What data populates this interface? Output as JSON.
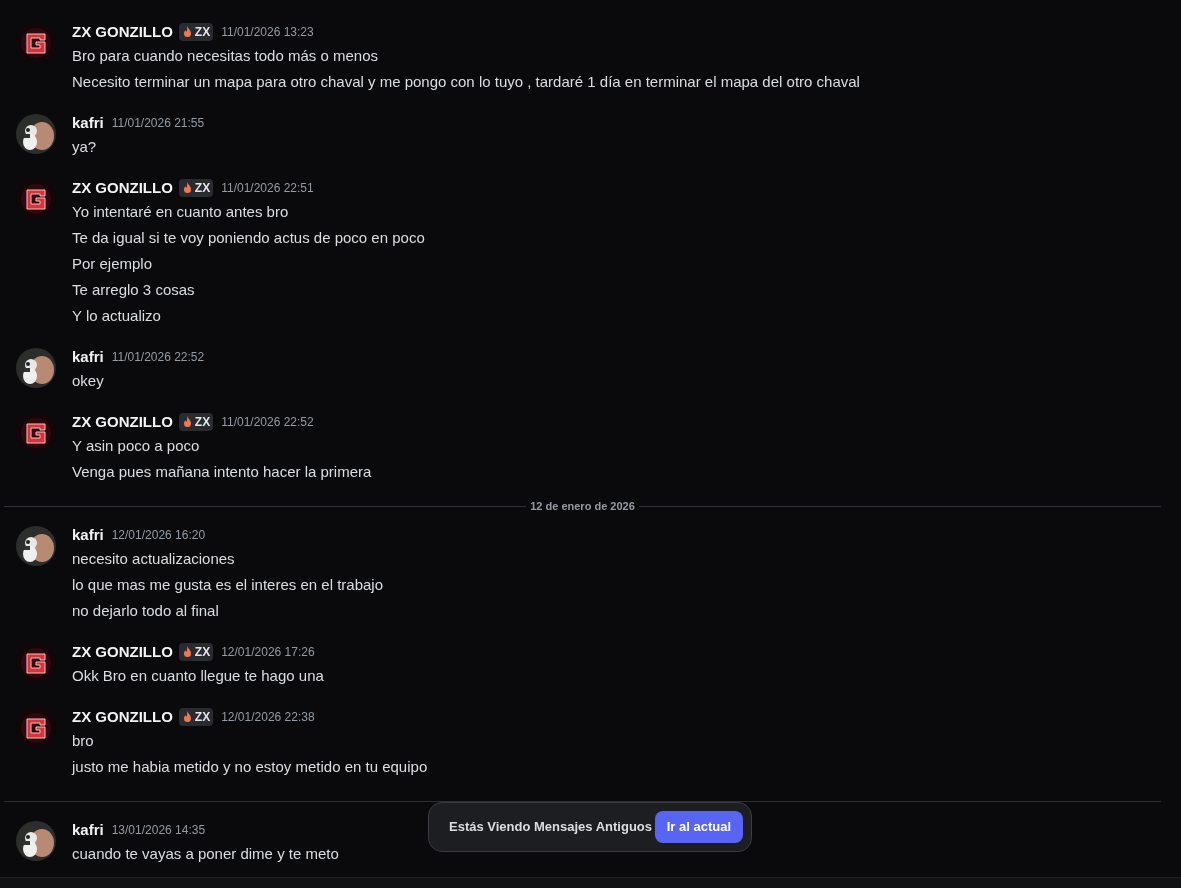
{
  "feed": [
    {
      "kind": "message",
      "avatar": {
        "kind": "logo"
      },
      "author": "ZX GONZILLO",
      "badge": "ZX",
      "time": "11/01/2026 13:23",
      "lines": [
        "Bro para cuando necesitas todo más o menos",
        "Necesito terminar un mapa para otro chaval y me pongo con lo tuyo , tardaré 1 día en terminar el mapa del otro chaval"
      ]
    },
    {
      "kind": "message",
      "avatar": {
        "kind": "photo"
      },
      "author": "kafri",
      "time": "11/01/2026 21:55",
      "lines": [
        "ya?"
      ]
    },
    {
      "kind": "message",
      "avatar": {
        "kind": "logo"
      },
      "author": "ZX GONZILLO",
      "badge": "ZX",
      "time": "11/01/2026 22:51",
      "lines": [
        "Yo intentaré en cuanto antes bro",
        "Te da igual si te voy poniendo actus de poco en poco",
        "Por ejemplo",
        "Te arreglo 3 cosas",
        "Y lo actualizo"
      ]
    },
    {
      "kind": "message",
      "avatar": {
        "kind": "photo"
      },
      "author": "kafri",
      "time": "11/01/2026 22:52",
      "lines": [
        "okey"
      ]
    },
    {
      "kind": "message",
      "avatar": {
        "kind": "logo"
      },
      "author": "ZX GONZILLO",
      "badge": "ZX",
      "time": "11/01/2026 22:52",
      "lines": [
        "Y asin poco a poco",
        "Venga pues mañana intento hacer la primera"
      ]
    },
    {
      "kind": "divider",
      "label": "12 de enero de 2026"
    },
    {
      "kind": "message",
      "avatar": {
        "kind": "photo"
      },
      "author": "kafri",
      "time": "12/01/2026 16:20",
      "lines": [
        "necesito actualizaciones",
        "lo que mas me gusta es el interes en el trabajo",
        "no dejarlo todo al final"
      ]
    },
    {
      "kind": "message",
      "avatar": {
        "kind": "logo"
      },
      "author": "ZX GONZILLO",
      "badge": "ZX",
      "time": "12/01/2026 17:26",
      "lines": [
        "Okk Bro en cuanto llegue te hago una"
      ]
    },
    {
      "kind": "message",
      "avatar": {
        "kind": "logo"
      },
      "author": "ZX GONZILLO",
      "badge": "ZX",
      "time": "12/01/2026 22:38",
      "lines": [
        "bro",
        "justo me habia metido y no estoy metido en tu equipo"
      ]
    },
    {
      "kind": "divider"
    },
    {
      "kind": "message",
      "avatar": {
        "kind": "photo"
      },
      "author": "kafri",
      "time": "13/01/2026 14:35",
      "lines": [
        "cuando te vayas a poner dime y te meto"
      ]
    }
  ],
  "toast": {
    "text": "Estás Viendo Mensajes Antiguos",
    "button": "Ir al actual"
  }
}
